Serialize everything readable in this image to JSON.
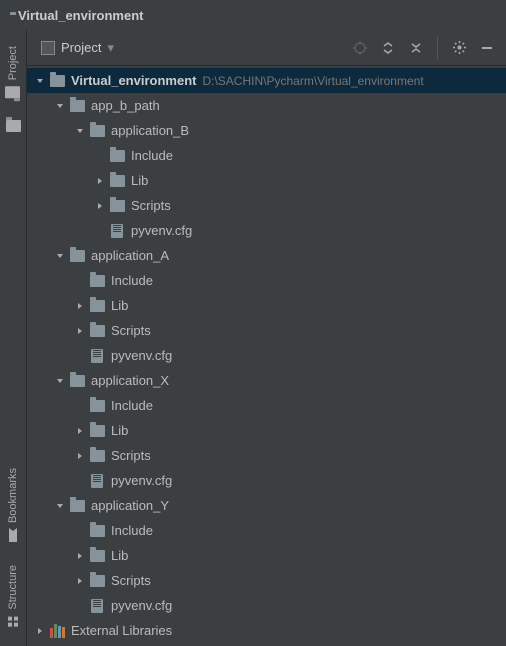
{
  "titlebar": {
    "title": "Virtual_environment"
  },
  "sidebar": {
    "project": "Project",
    "bookmarks": "Bookmarks",
    "structure": "Structure"
  },
  "panelHeader": {
    "title": "Project"
  },
  "root": {
    "name": "Virtual_environment",
    "path": "D:\\SACHIN\\Pycharm\\Virtual_environment"
  },
  "tree": {
    "app_b_path": "app_b_path",
    "application_B": "application_B",
    "application_A": "application_A",
    "application_X": "application_X",
    "application_Y": "application_Y",
    "Include": "Include",
    "Lib": "Lib",
    "Scripts": "Scripts",
    "pyvenv": "pyvenv.cfg",
    "extlib": "External Libraries"
  }
}
